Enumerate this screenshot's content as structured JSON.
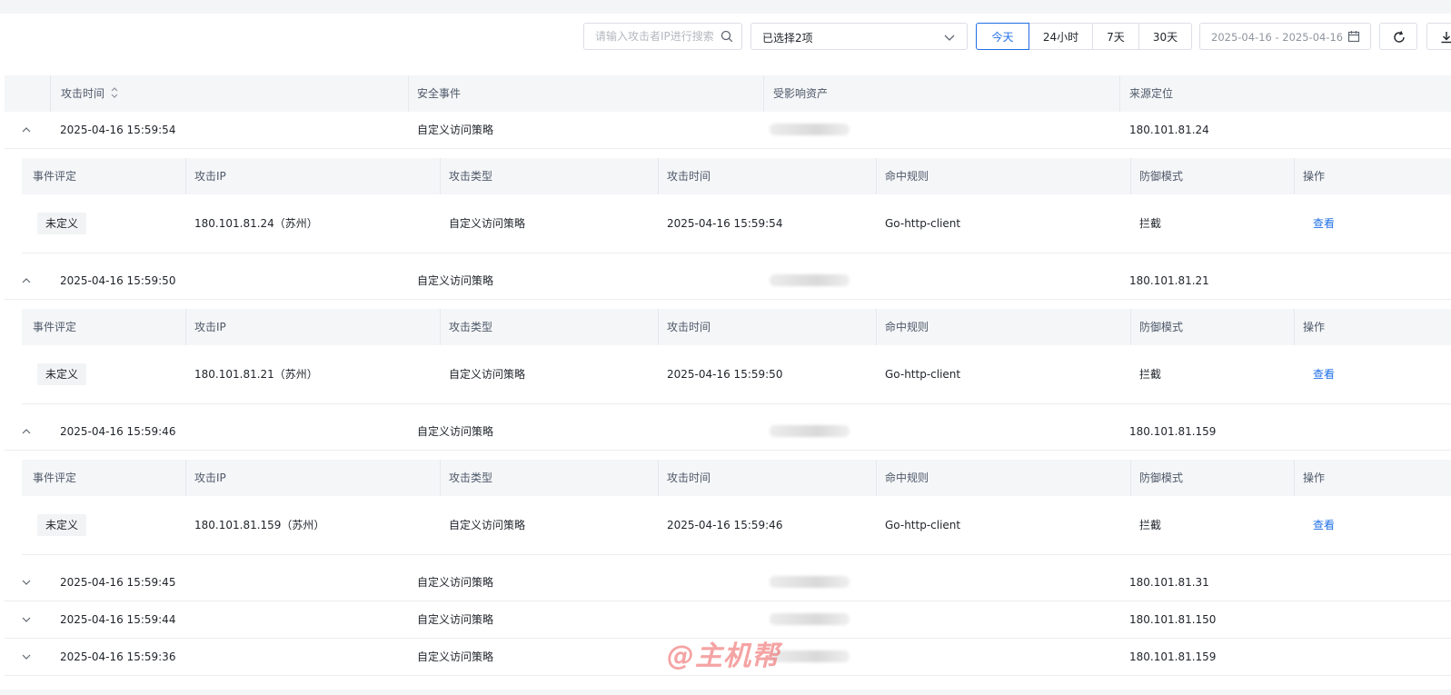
{
  "toolbar": {
    "search_placeholder": "请输入攻击者IP进行搜索",
    "select_value": "已选择2项",
    "time_ranges": [
      "今天",
      "24小时",
      "7天",
      "30天"
    ],
    "active_range": "今天",
    "date_range": "2025-04-16 - 2025-04-16"
  },
  "table": {
    "headers": [
      "攻击时间",
      "安全事件",
      "受影响资产",
      "来源定位"
    ],
    "sub_headers": [
      "事件评定",
      "攻击IP",
      "攻击类型",
      "攻击时间",
      "命中规则",
      "防御模式",
      "操作"
    ],
    "rows": [
      {
        "time": "2025-04-16 15:59:54",
        "event": "自定义访问策略",
        "location": "180.101.81.24",
        "expanded": true,
        "detail": {
          "rating": "未定义",
          "ip": "180.101.81.24（苏州）",
          "type": "自定义访问策略",
          "time": "2025-04-16 15:59:54",
          "rule": "Go-http-client",
          "mode": "拦截",
          "action": "查看"
        }
      },
      {
        "time": "2025-04-16 15:59:50",
        "event": "自定义访问策略",
        "location": "180.101.81.21",
        "expanded": true,
        "detail": {
          "rating": "未定义",
          "ip": "180.101.81.21（苏州）",
          "type": "自定义访问策略",
          "time": "2025-04-16 15:59:50",
          "rule": "Go-http-client",
          "mode": "拦截",
          "action": "查看"
        }
      },
      {
        "time": "2025-04-16 15:59:46",
        "event": "自定义访问策略",
        "location": "180.101.81.159",
        "expanded": true,
        "detail": {
          "rating": "未定义",
          "ip": "180.101.81.159（苏州）",
          "type": "自定义访问策略",
          "time": "2025-04-16 15:59:46",
          "rule": "Go-http-client",
          "mode": "拦截",
          "action": "查看"
        }
      },
      {
        "time": "2025-04-16 15:59:45",
        "event": "自定义访问策略",
        "location": "180.101.81.31",
        "expanded": false
      },
      {
        "time": "2025-04-16 15:59:44",
        "event": "自定义访问策略",
        "location": "180.101.81.150",
        "expanded": false
      },
      {
        "time": "2025-04-16 15:59:36",
        "event": "自定义访问策略",
        "location": "180.101.81.159",
        "expanded": false
      }
    ]
  },
  "watermark": "@主机帮",
  "icons": {
    "search": "search-icon",
    "dropdown": "chevron-down-icon",
    "calendar": "calendar-icon",
    "refresh": "refresh-icon",
    "download": "download-icon",
    "sort": "sort-icon",
    "expanded": "chevron-up-icon",
    "collapsed": "chevron-down-icon"
  },
  "colors": {
    "accent": "#1f6fe5",
    "watermark": "#ec5858"
  }
}
